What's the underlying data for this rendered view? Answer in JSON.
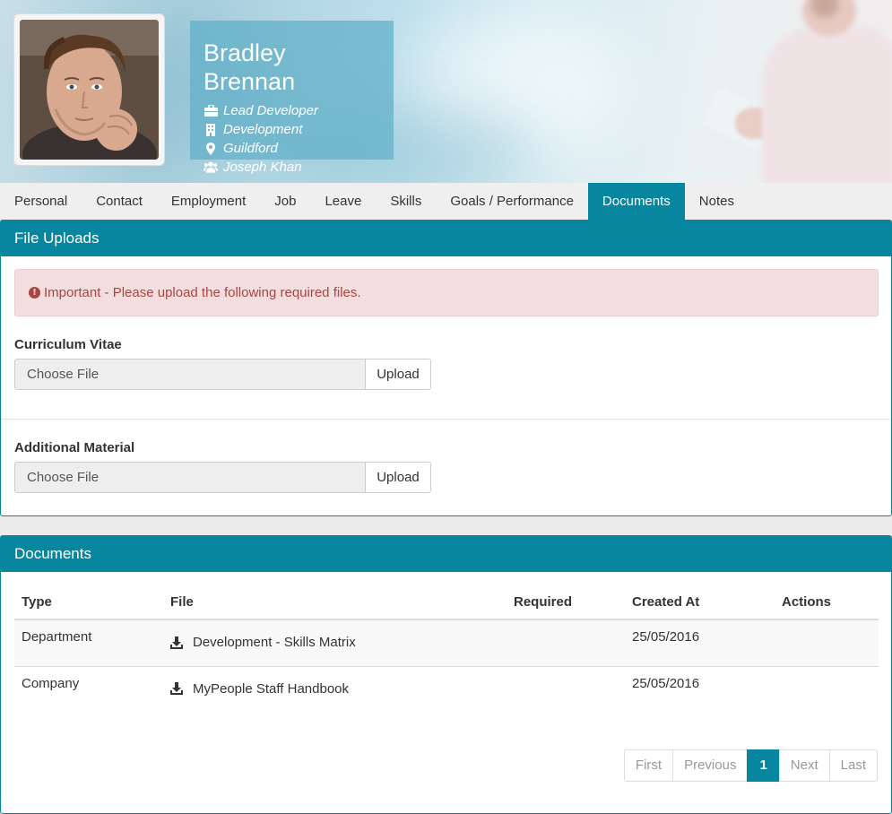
{
  "profile": {
    "name": "Bradley Brennan",
    "job_title": "Lead Developer",
    "department": "Development",
    "location": "Guildford",
    "manager": "Joseph Khan",
    "icons": [
      "briefcase-icon",
      "building-icon",
      "map-marker-icon",
      "users-icon"
    ]
  },
  "tabs": [
    {
      "label": "Personal",
      "active": false
    },
    {
      "label": "Contact",
      "active": false
    },
    {
      "label": "Employment",
      "active": false
    },
    {
      "label": "Job",
      "active": false
    },
    {
      "label": "Leave",
      "active": false
    },
    {
      "label": "Skills",
      "active": false
    },
    {
      "label": "Goals / Performance",
      "active": false
    },
    {
      "label": "Documents",
      "active": true
    },
    {
      "label": "Notes",
      "active": false
    }
  ],
  "uploads": {
    "title": "File Uploads",
    "alert": "Important - Please upload the following required files.",
    "fields": [
      {
        "label": "Curriculum Vitae",
        "placeholder": "Choose File",
        "button": "Upload"
      },
      {
        "label": "Additional Material",
        "placeholder": "Choose File",
        "button": "Upload"
      }
    ]
  },
  "documents": {
    "title": "Documents",
    "columns": [
      "Type",
      "File",
      "Required",
      "Created At",
      "Actions"
    ],
    "rows": [
      {
        "type": "Department",
        "file": "Development - Skills Matrix",
        "required": "",
        "created": "25/05/2016",
        "actions": ""
      },
      {
        "type": "Company",
        "file": "MyPeople Staff Handbook",
        "required": "",
        "created": "25/05/2016",
        "actions": ""
      }
    ],
    "pagination": {
      "first": "First",
      "previous": "Previous",
      "current": "1",
      "next": "Next",
      "last": "Last"
    }
  },
  "colors": {
    "accent": "#09869f",
    "alert_bg": "#f2dede",
    "alert_text": "#a94442"
  }
}
